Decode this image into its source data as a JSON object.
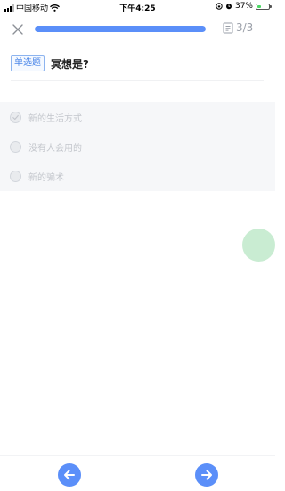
{
  "status_bar": {
    "carrier": "中国移动",
    "time": "下午4:25",
    "battery_text": "37%",
    "battery_level": 0.37
  },
  "header": {
    "progress": 1.0,
    "counter": "3/3"
  },
  "question": {
    "type_badge": "单选题",
    "text": "冥想是?"
  },
  "options": [
    {
      "label": "新的生活方式",
      "selected": true
    },
    {
      "label": "没有人会用的",
      "selected": false
    },
    {
      "label": "新的骗术",
      "selected": false
    }
  ],
  "colors": {
    "accent": "#5b8ff9",
    "float_button": "#c9ecd2"
  },
  "icons": {
    "close": "close-icon",
    "counter": "document-icon",
    "prev": "arrow-left-icon",
    "next": "arrow-right-icon"
  }
}
